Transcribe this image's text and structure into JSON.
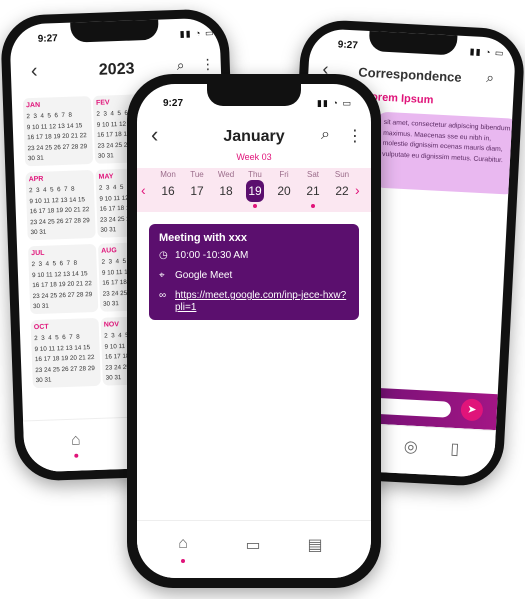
{
  "status_time": "9:27",
  "left_phone": {
    "year_title": "2023",
    "months": [
      {
        "name": "JAN",
        "col": 0,
        "row": 0
      },
      {
        "name": "FEV",
        "col": 1,
        "row": 0
      },
      {
        "name": "APR",
        "col": 0,
        "row": 1
      },
      {
        "name": "MAY",
        "col": 1,
        "row": 1
      },
      {
        "name": "JUL",
        "col": 0,
        "row": 2
      },
      {
        "name": "AUG",
        "col": 1,
        "row": 2
      },
      {
        "name": "OCT",
        "col": 0,
        "row": 3
      },
      {
        "name": "NOV",
        "col": 1,
        "row": 3
      }
    ],
    "month_weeks": "2  3  4  5  6  7  8\n9 10 11 12 13 14 15\n16 17 18 19 20 21 22\n23 24 25 26 27 28 29\n30 31"
  },
  "right_phone": {
    "title": "Correspondence",
    "subject": "orem Ipsum",
    "message": "sit amet, consectetur adipiscing bibendum maximus. Maecenas sse eu nibh in, molestie dignissim ecenas mauris diam, vulputate eu dignissim metus. Curabitur."
  },
  "mid_phone": {
    "month_title": "January",
    "week_label": "Week 03",
    "days": [
      {
        "name": "Mon",
        "num": "16"
      },
      {
        "name": "Tue",
        "num": "17"
      },
      {
        "name": "Wed",
        "num": "18"
      },
      {
        "name": "Thu",
        "num": "19"
      },
      {
        "name": "Fri",
        "num": "20"
      },
      {
        "name": "Sat",
        "num": "21"
      },
      {
        "name": "Sun",
        "num": "22"
      }
    ],
    "selected_index": 3,
    "event": {
      "title": "Meeting with xxx",
      "time": "10:00 -10:30 AM",
      "location": "Google Meet",
      "link": "https://meet.google.com/inp-jece-hxw?pli=1"
    }
  },
  "colors": {
    "accent": "#e0147a",
    "primary": "#5b0f6e",
    "bubble": "#e9b8f0"
  }
}
